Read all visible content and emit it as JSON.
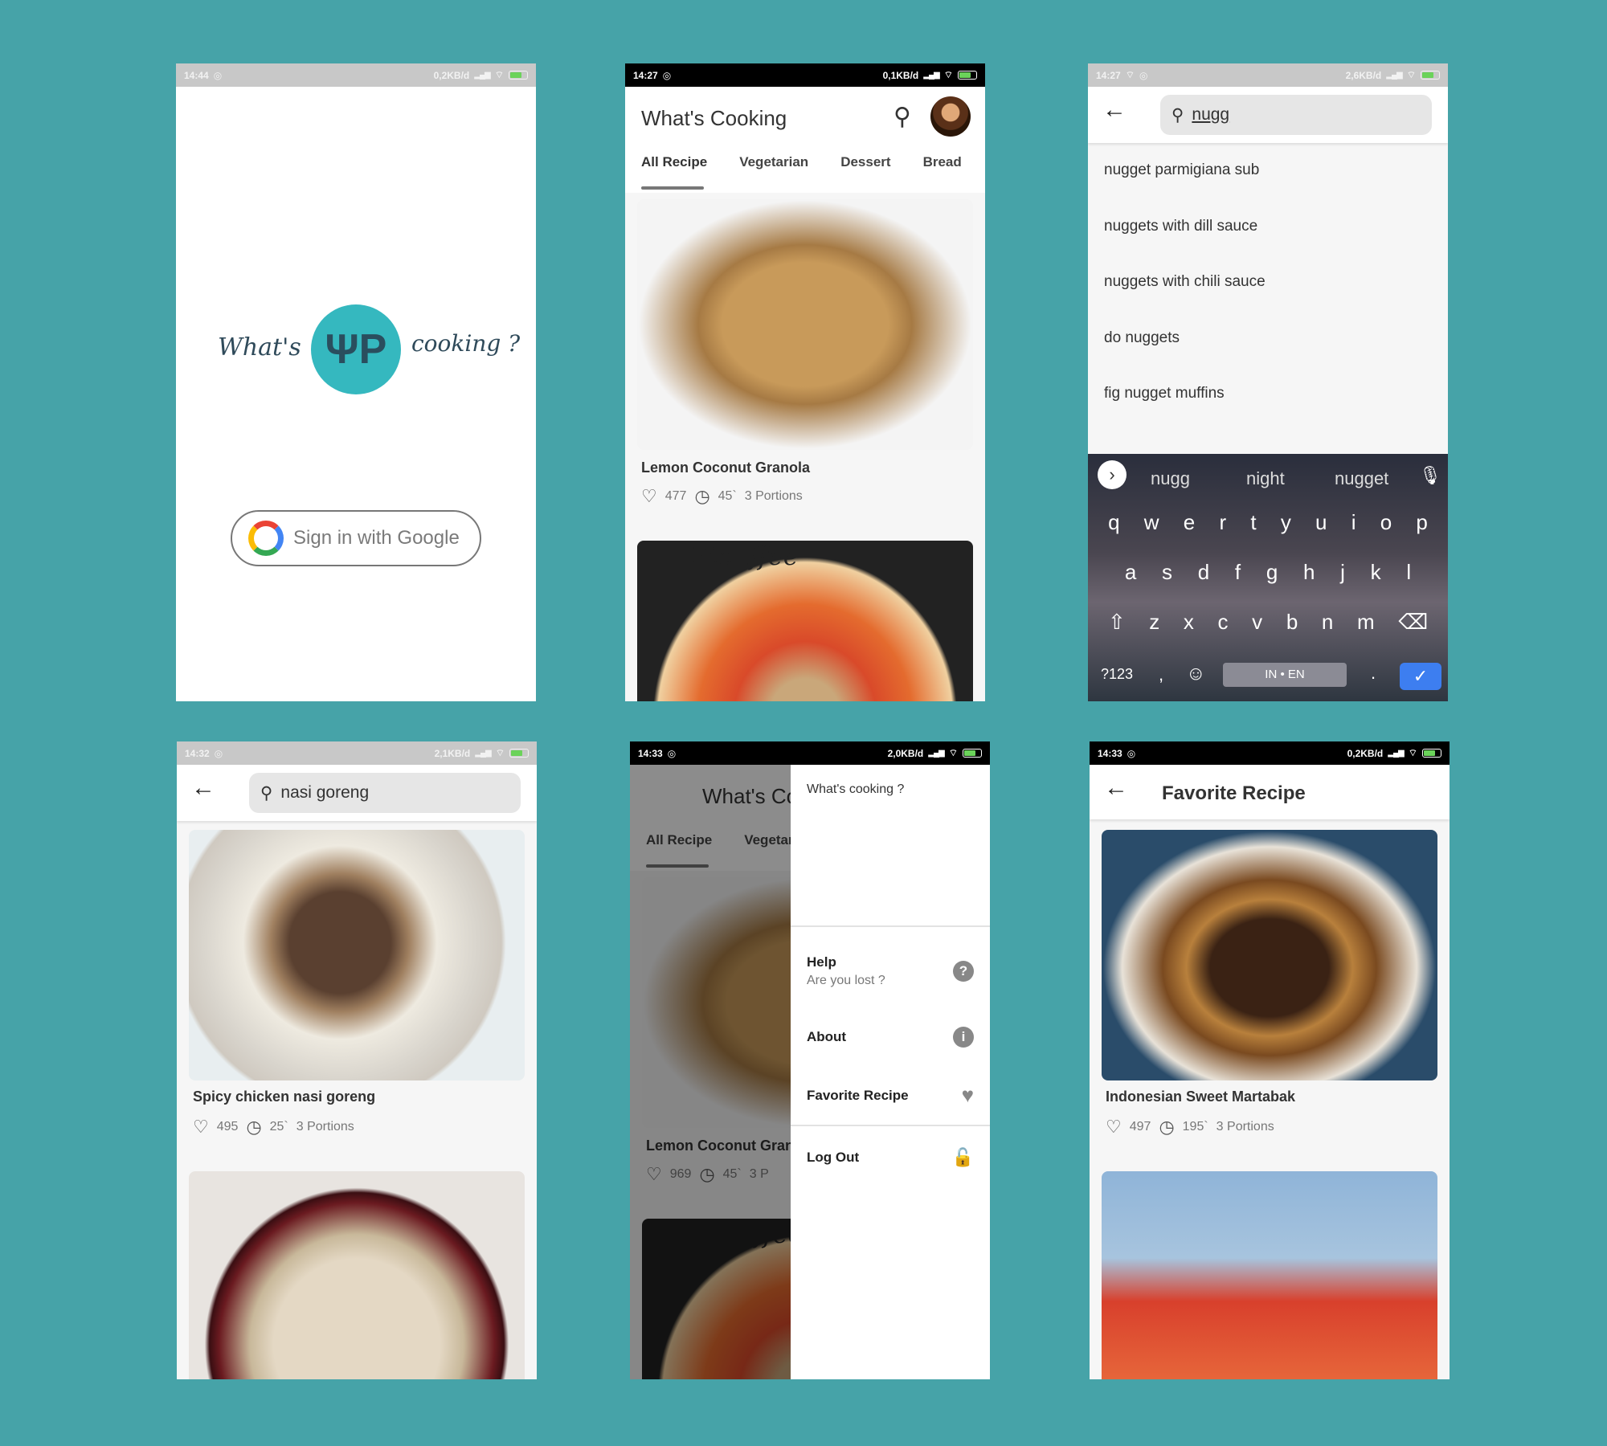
{
  "background_color": "#46a3a8",
  "accent_color": "#35b8bf",
  "phone1": {
    "status": {
      "time": "14:44",
      "speed": "0,2KB/d"
    },
    "brand_left": "What's",
    "brand_right": "cooking ?",
    "sign_in_label": "Sign in with Google"
  },
  "phone2": {
    "status": {
      "time": "14:27",
      "speed": "0,1KB/d"
    },
    "title": "What's Cooking",
    "tabs": [
      "All Recipe",
      "Vegetarian",
      "Dessert",
      "Bread"
    ],
    "recipe": {
      "title": "Lemon Coconut Granola",
      "likes": "477",
      "time": "45`",
      "portions": "3 Portions"
    },
    "next_photo_caption": "Etouffee"
  },
  "phone3": {
    "status": {
      "time": "14:27",
      "speed": "2,6KB/d"
    },
    "query": "nugg",
    "suggestions": [
      "nugget parmigiana sub",
      "nuggets with dill sauce",
      "nuggets with chili sauce",
      "do nuggets",
      "fig nugget muffins"
    ],
    "keyboard": {
      "predictions": [
        "nugg",
        "night",
        "nugget"
      ],
      "row1": [
        "q",
        "w",
        "e",
        "r",
        "t",
        "y",
        "u",
        "i",
        "o",
        "p"
      ],
      "row2": [
        "a",
        "s",
        "d",
        "f",
        "g",
        "h",
        "j",
        "k",
        "l"
      ],
      "row3": [
        "z",
        "x",
        "c",
        "v",
        "b",
        "n",
        "m"
      ],
      "symbols_key": "?123",
      "comma_key": ",",
      "space_label": "IN • EN",
      "period_key": "."
    }
  },
  "phone4": {
    "status": {
      "time": "14:32",
      "speed": "2,1KB/d"
    },
    "query": "nasi goreng",
    "recipe": {
      "title": "Spicy chicken nasi goreng",
      "likes": "495",
      "time": "25`",
      "portions": "3 Portions"
    }
  },
  "phone5": {
    "status": {
      "time": "14:33",
      "speed": "2,0KB/d"
    },
    "bg_title": "What's Co",
    "bg_tabs": [
      "All Recipe",
      "Vegetar"
    ],
    "bg_recipe": {
      "title": "Lemon Coconut Gran",
      "likes": "969",
      "time": "45`",
      "portions": "3 P"
    },
    "bg_photo_caption": "Etouffee",
    "drawer": {
      "title": "What's cooking ?",
      "help_label": "Help",
      "help_sub": "Are you lost ?",
      "about_label": "About",
      "favorite_label": "Favorite Recipe",
      "logout_label": "Log Out"
    }
  },
  "phone6": {
    "status": {
      "time": "14:33",
      "speed": "0,2KB/d"
    },
    "title": "Favorite Recipe",
    "recipe": {
      "title": "Indonesian Sweet Martabak",
      "likes": "497",
      "time": "195`",
      "portions": "3 Portions"
    }
  }
}
